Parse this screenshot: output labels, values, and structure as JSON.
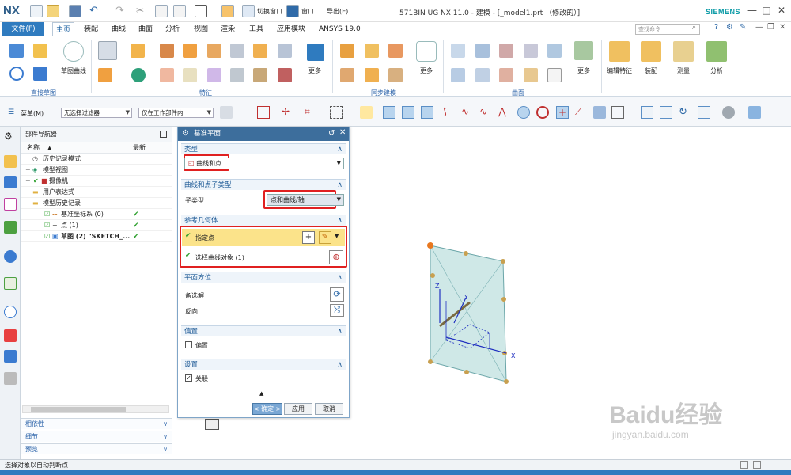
{
  "app": {
    "logo": "NX",
    "window_title": "571BIN UG NX 11.0 - 建模 - [_model1.prt （修改的）]",
    "brand": "SIEMENS",
    "switch_window": "切换窗口",
    "window_menu": "窗口",
    "export_menu": "导出(E)",
    "window_controls": [
      "—",
      "□",
      "✕"
    ]
  },
  "ribbon": {
    "file_tab": "文件(F)",
    "tabs": [
      "主页",
      "装配",
      "曲线",
      "曲面",
      "分析",
      "视图",
      "渲染",
      "工具",
      "应用模块",
      "ANSYS 19.0"
    ],
    "active_tab": "主页",
    "search_placeholder": "查找命令",
    "groups": {
      "direct_sketch": "直接草图",
      "feature": "特征",
      "sync_modeling": "同步建模",
      "surface": "曲面"
    },
    "big_buttons": {
      "sketch_curve": "草图曲线",
      "more1": "更多",
      "more2": "更多",
      "more3": "更多",
      "edit_feature": "编辑特征",
      "assembly": "装配",
      "measure": "测量",
      "analysis": "分析"
    }
  },
  "toolbar": {
    "menu_label": "菜单(M)",
    "filter_value": "无选择过滤器",
    "scope_value": "仅在工作部件内"
  },
  "navigator": {
    "title": "部件导航器",
    "col_name": "名称",
    "col_latest": "最新",
    "rows": [
      {
        "label": "历史记录模式",
        "icon": "clock-icon",
        "latest": ""
      },
      {
        "label": "模型视图",
        "icon": "views-icon",
        "latest": ""
      },
      {
        "label": "摄像机",
        "icon": "camera-icon",
        "latest": ""
      },
      {
        "label": "用户表达式",
        "icon": "folder-icon",
        "latest": ""
      },
      {
        "label": "模型历史记录",
        "icon": "folder-icon",
        "latest": ""
      },
      {
        "label": "基准坐标系 (0)",
        "icon": "datum-csys-icon",
        "latest": "✔"
      },
      {
        "label": "点 (1)",
        "icon": "point-icon",
        "latest": "✔"
      },
      {
        "label": "草图 (2) \"SKETCH_...",
        "icon": "sketch-icon",
        "latest": "✔"
      }
    ],
    "sections": [
      "相依性",
      "细节",
      "预览"
    ]
  },
  "dialog": {
    "title": "基准平面",
    "type_header": "类型",
    "type_value": "曲线和点",
    "subtype_header": "曲线和点子类型",
    "subtype_label": "子类型",
    "subtype_value": "点和曲线/轴",
    "ref_header": "参考几何体",
    "specify_point": "指定点",
    "select_curve": "选择曲线对象 (1)",
    "orient_header": "平面方位",
    "alternate": "备选解",
    "reverse": "反向",
    "offset_header": "偏置",
    "offset_check": "偏置",
    "settings_header": "设置",
    "associative": "关联",
    "ok": "< 确定 >",
    "apply": "应用",
    "cancel": "取消"
  },
  "graphics": {
    "axis_x": "X",
    "axis_y": "Y",
    "axis_z": "Z",
    "triad_x": "X",
    "watermark": "Baidu经验",
    "watermark_url": "jingyan.baidu.com"
  },
  "status_bar": {
    "text": "选择对象以自动判断点"
  }
}
